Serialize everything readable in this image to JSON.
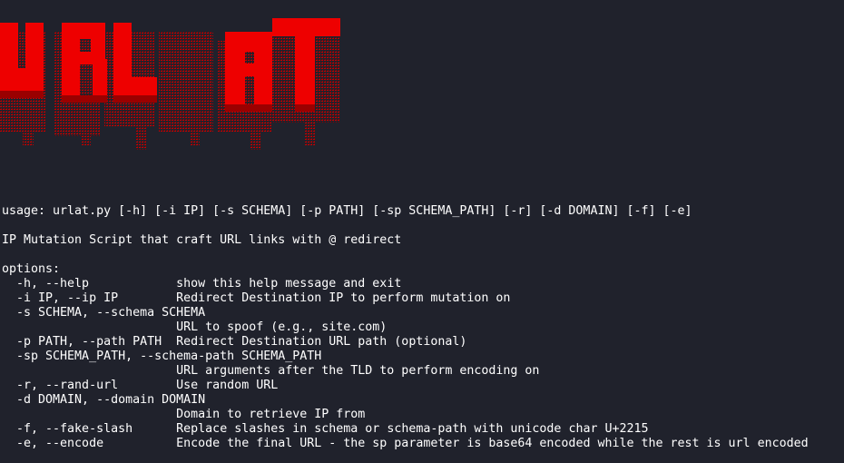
{
  "banner": {
    "text": "URL AT",
    "color": "#ee0000",
    "shadow_color": "#9a0000"
  },
  "help": {
    "usage": "usage: urlat.py [-h] [-i IP] [-s SCHEMA] [-p PATH] [-sp SCHEMA_PATH] [-r] [-d DOMAIN] [-f] [-e]",
    "description": "IP Mutation Script that craft URL links with @ redirect",
    "options_header": "options:",
    "options": [
      {
        "name": "help",
        "flags": "  -h, --help",
        "desc": "show this help message and exit"
      },
      {
        "name": "ip",
        "flags": "  -i IP, --ip IP",
        "desc": "Redirect Destination IP to perform mutation on"
      },
      {
        "name": "schema",
        "flags": "  -s SCHEMA, --schema SCHEMA",
        "desc": "URL to spoof (e.g., site.com)"
      },
      {
        "name": "path",
        "flags": "  -p PATH, --path PATH",
        "desc": "Redirect Destination URL path (optional)"
      },
      {
        "name": "schema-path",
        "flags": "  -sp SCHEMA_PATH, --schema-path SCHEMA_PATH",
        "desc": "URL arguments after the TLD to perform encoding on"
      },
      {
        "name": "rand-url",
        "flags": "  -r, --rand-url",
        "desc": "Use random URL"
      },
      {
        "name": "domain",
        "flags": "  -d DOMAIN, --domain DOMAIN",
        "desc": "Domain to retrieve IP from"
      },
      {
        "name": "fake-slash",
        "flags": "  -f, --fake-slash",
        "desc": "Replace slashes in schema or schema-path with unicode char U+2215"
      },
      {
        "name": "encode",
        "flags": "  -e, --encode",
        "desc": "Encode the final URL - the sp parameter is base64 encoded while the rest is url encoded"
      }
    ]
  }
}
